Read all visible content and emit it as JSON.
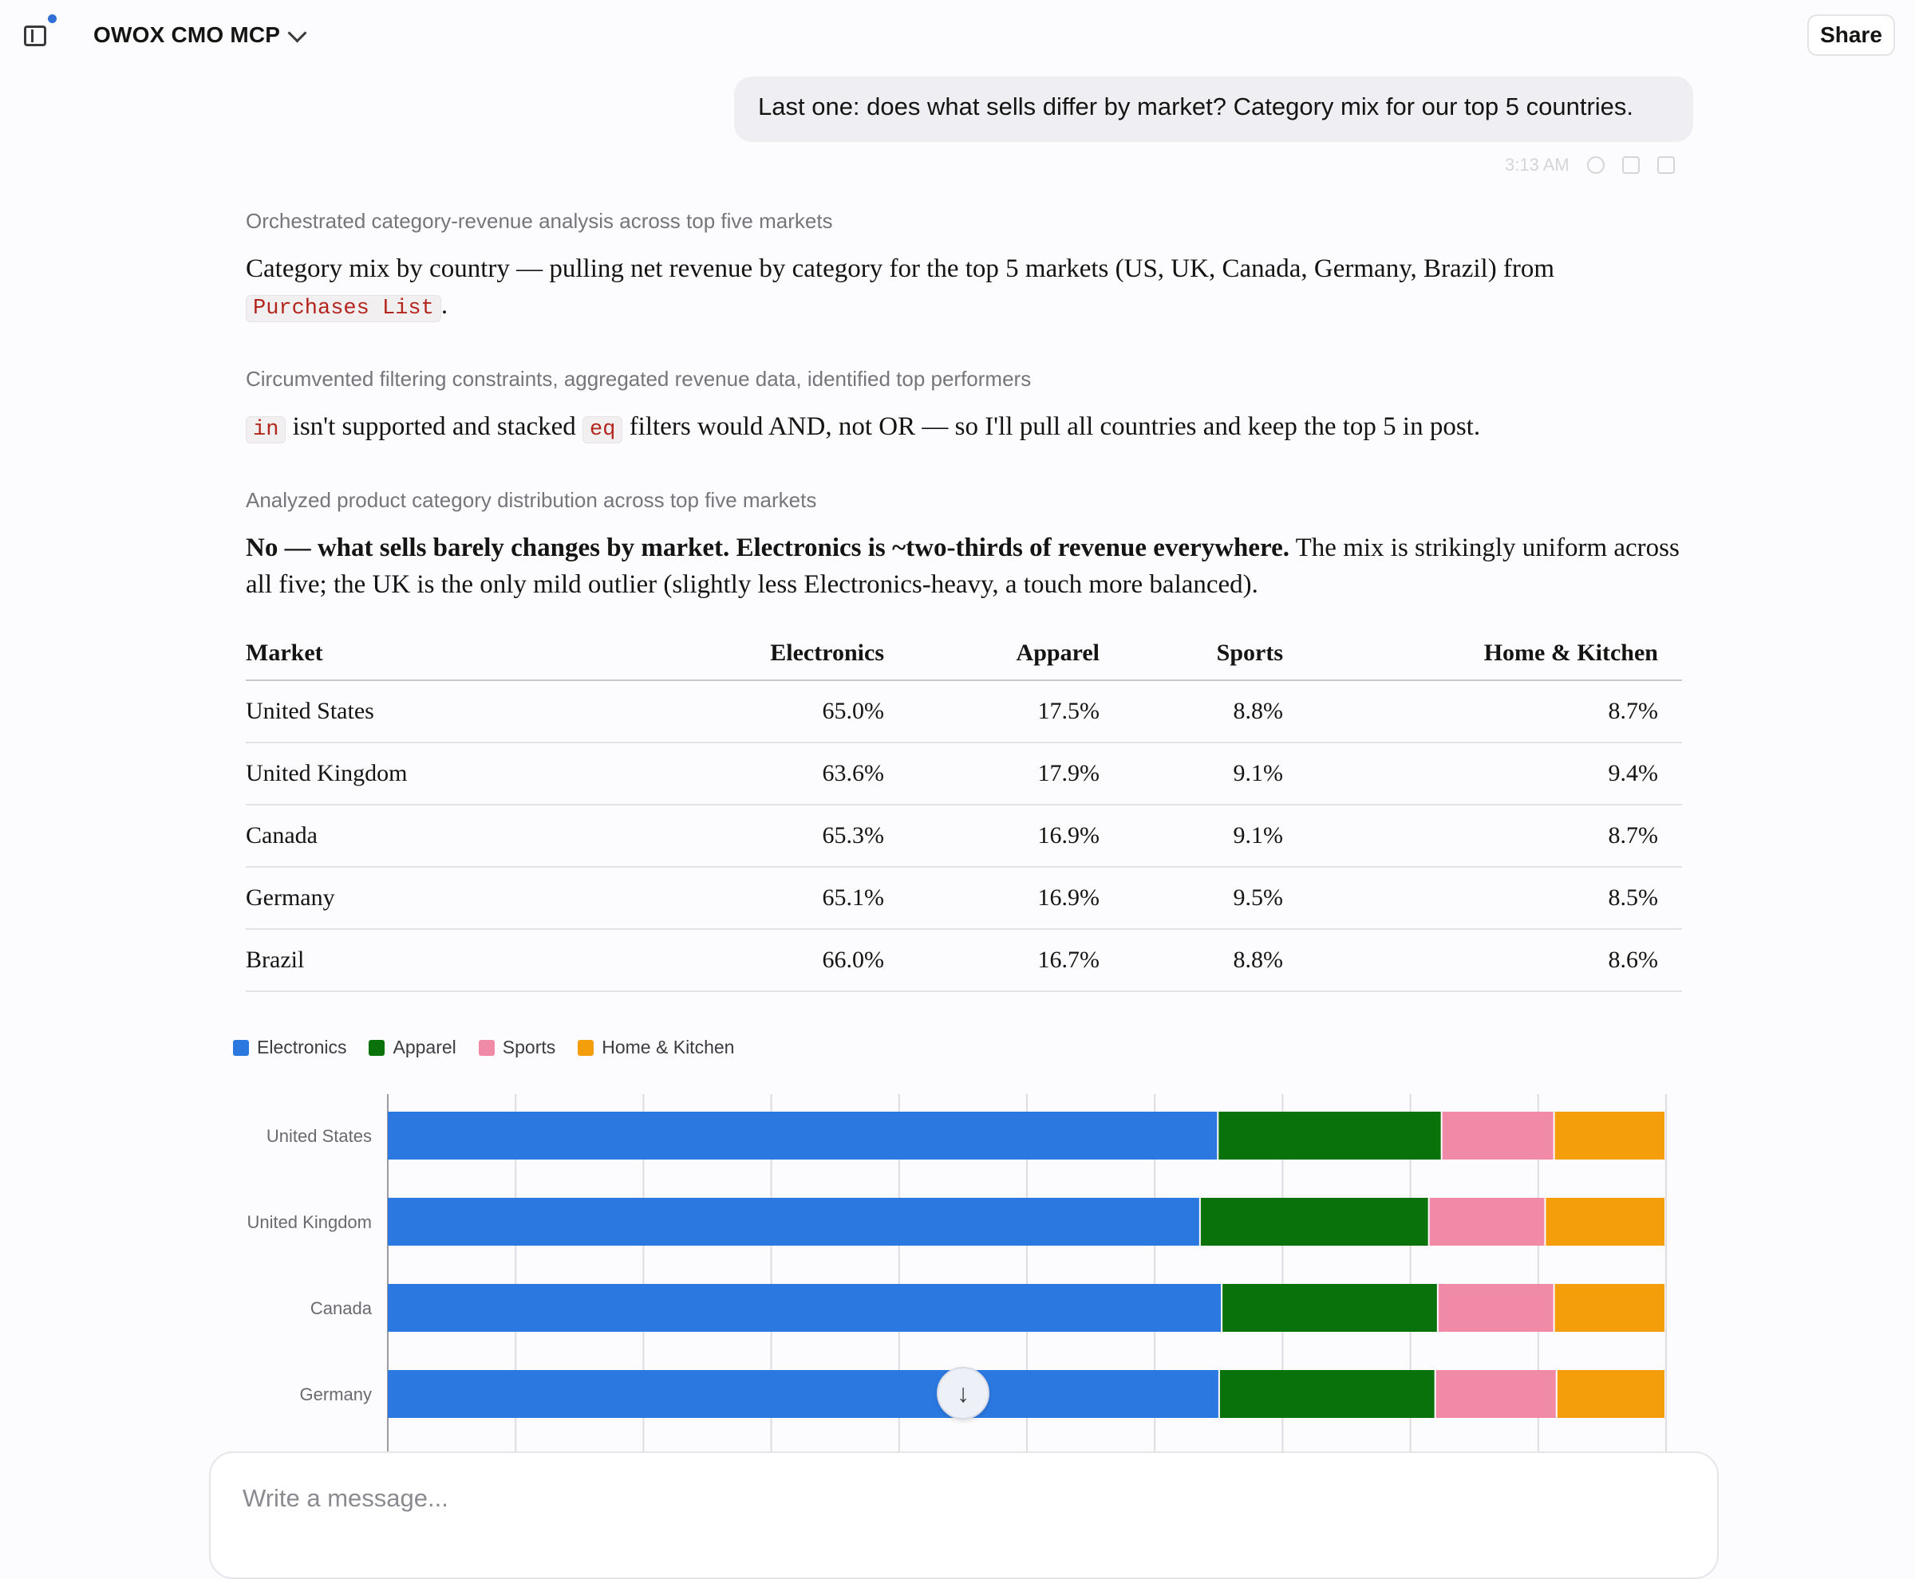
{
  "header": {
    "project_title": "OWOX CMO MCP",
    "share_label": "Share"
  },
  "user_message": {
    "text": "Last one: does what sells differ by market? Category mix for our top 5 countries.",
    "time": "3:13 AM"
  },
  "steps": [
    "Orchestrated category-revenue analysis across top five markets",
    "Circumvented filtering constraints, aggregated revenue data, identified top performers",
    "Analyzed product category distribution across top five markets"
  ],
  "para1": {
    "text": "Category mix by country — pulling net revenue by category for the top 5 markets (US, UK, Canada, Germany, Brazil) from ",
    "code": "Purchases List",
    "end": "."
  },
  "para2": {
    "code1": "in",
    "text1": " isn't supported and stacked ",
    "code2": "eq",
    "text2": " filters would AND, not OR — so I'll pull all countries and keep the top 5 in post."
  },
  "para3": {
    "bold": "No — what sells barely changes by market. Electronics is ~two-thirds of revenue everywhere.",
    "text": " The mix is strikingly uniform across all five; the UK is the only mild outlier (slightly less Electronics-heavy, a touch more balanced)."
  },
  "table": {
    "headers": [
      "Market",
      "Electronics",
      "Apparel",
      "Sports",
      "Home & Kitchen"
    ],
    "rows": [
      [
        "United States",
        "65.0%",
        "17.5%",
        "8.8%",
        "8.7%"
      ],
      [
        "United Kingdom",
        "63.6%",
        "17.9%",
        "9.1%",
        "9.4%"
      ],
      [
        "Canada",
        "65.3%",
        "16.9%",
        "9.1%",
        "8.7%"
      ],
      [
        "Germany",
        "65.1%",
        "16.9%",
        "9.5%",
        "8.5%"
      ],
      [
        "Brazil",
        "66.0%",
        "16.7%",
        "8.8%",
        "8.6%"
      ]
    ]
  },
  "chart_data": {
    "type": "bar",
    "orientation": "horizontal",
    "stacked": true,
    "categories": [
      "United States",
      "United Kingdom",
      "Canada",
      "Germany"
    ],
    "series": [
      {
        "name": "Electronics",
        "color": "#2a78e0",
        "values": [
          65.0,
          63.6,
          65.3,
          65.1
        ]
      },
      {
        "name": "Apparel",
        "color": "#0a720a",
        "values": [
          17.5,
          17.9,
          16.9,
          16.9
        ]
      },
      {
        "name": "Sports",
        "color": "#f08aa6",
        "values": [
          8.8,
          9.1,
          9.1,
          9.5
        ]
      },
      {
        "name": "Home & Kitchen",
        "color": "#f59e0b",
        "values": [
          8.7,
          9.4,
          8.7,
          8.5
        ]
      }
    ],
    "xlim": [
      0,
      100
    ],
    "grid": true,
    "legend_position": "top-left"
  },
  "scroll_icon": "arrow-down-icon",
  "composer": {
    "placeholder": "Write a message..."
  }
}
